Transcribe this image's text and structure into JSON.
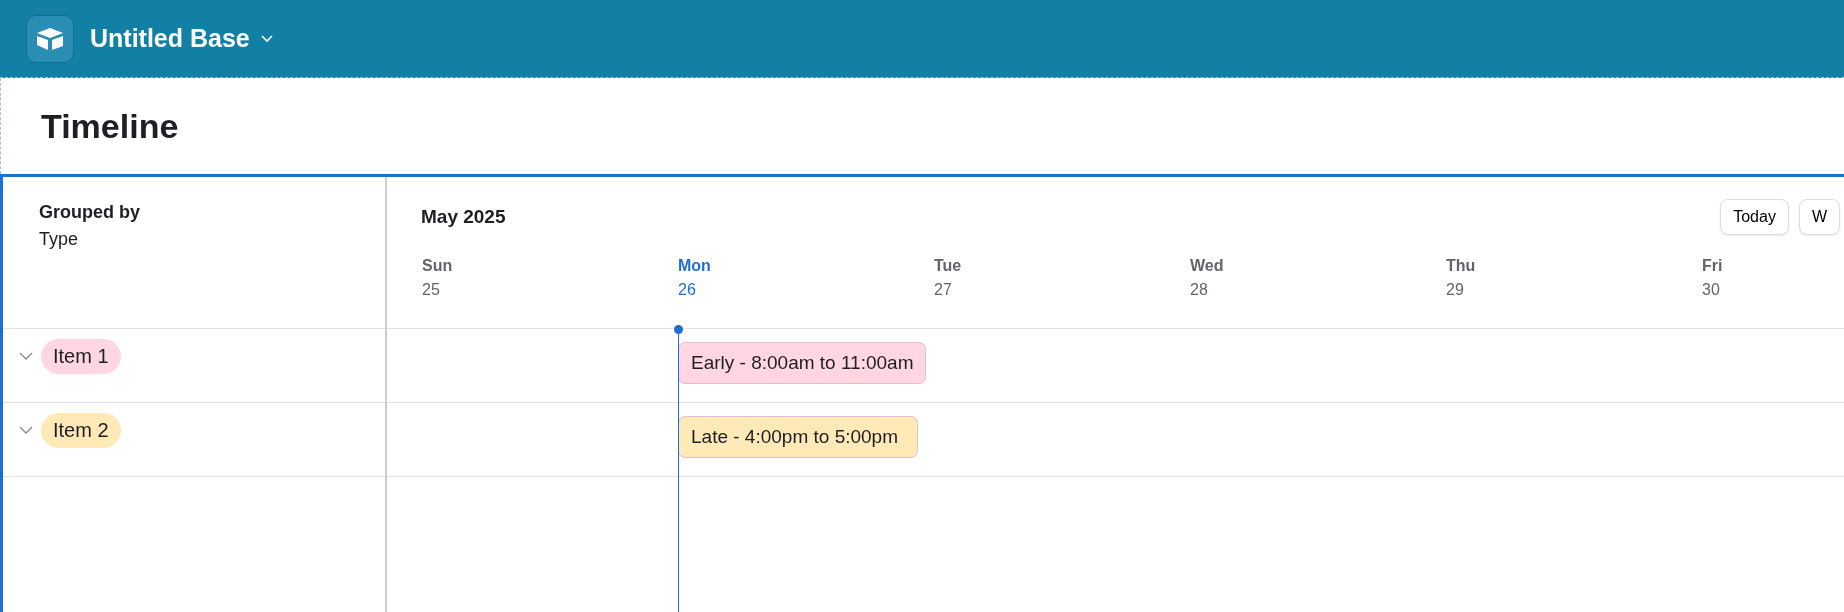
{
  "app": {
    "title": "Untitled Base"
  },
  "page": {
    "title": "Timeline"
  },
  "grouping": {
    "label": "Grouped by",
    "field": "Type"
  },
  "timeline": {
    "month": "May 2025",
    "buttons": [
      "Today",
      "W"
    ],
    "days": [
      {
        "name": "Sun",
        "date": "25",
        "selected": false
      },
      {
        "name": "Mon",
        "date": "26",
        "selected": true
      },
      {
        "name": "Tue",
        "date": "27",
        "selected": false
      },
      {
        "name": "Wed",
        "date": "28",
        "selected": false
      },
      {
        "name": "Thu",
        "date": "29",
        "selected": false
      },
      {
        "name": "Fri",
        "date": "30",
        "selected": false
      }
    ]
  },
  "groups": [
    {
      "label": "Item 1",
      "color": "#ffd6e1",
      "expanded": true,
      "events": [
        {
          "label": "Early - 8:00am to 11:00am",
          "color": "#ffd6e1"
        }
      ]
    },
    {
      "label": "Item 2",
      "color": "#ffe9b6",
      "expanded": true,
      "events": [
        {
          "label": "Late - 4:00pm to 5:00pm",
          "color": "#ffe9b6"
        }
      ]
    }
  ]
}
